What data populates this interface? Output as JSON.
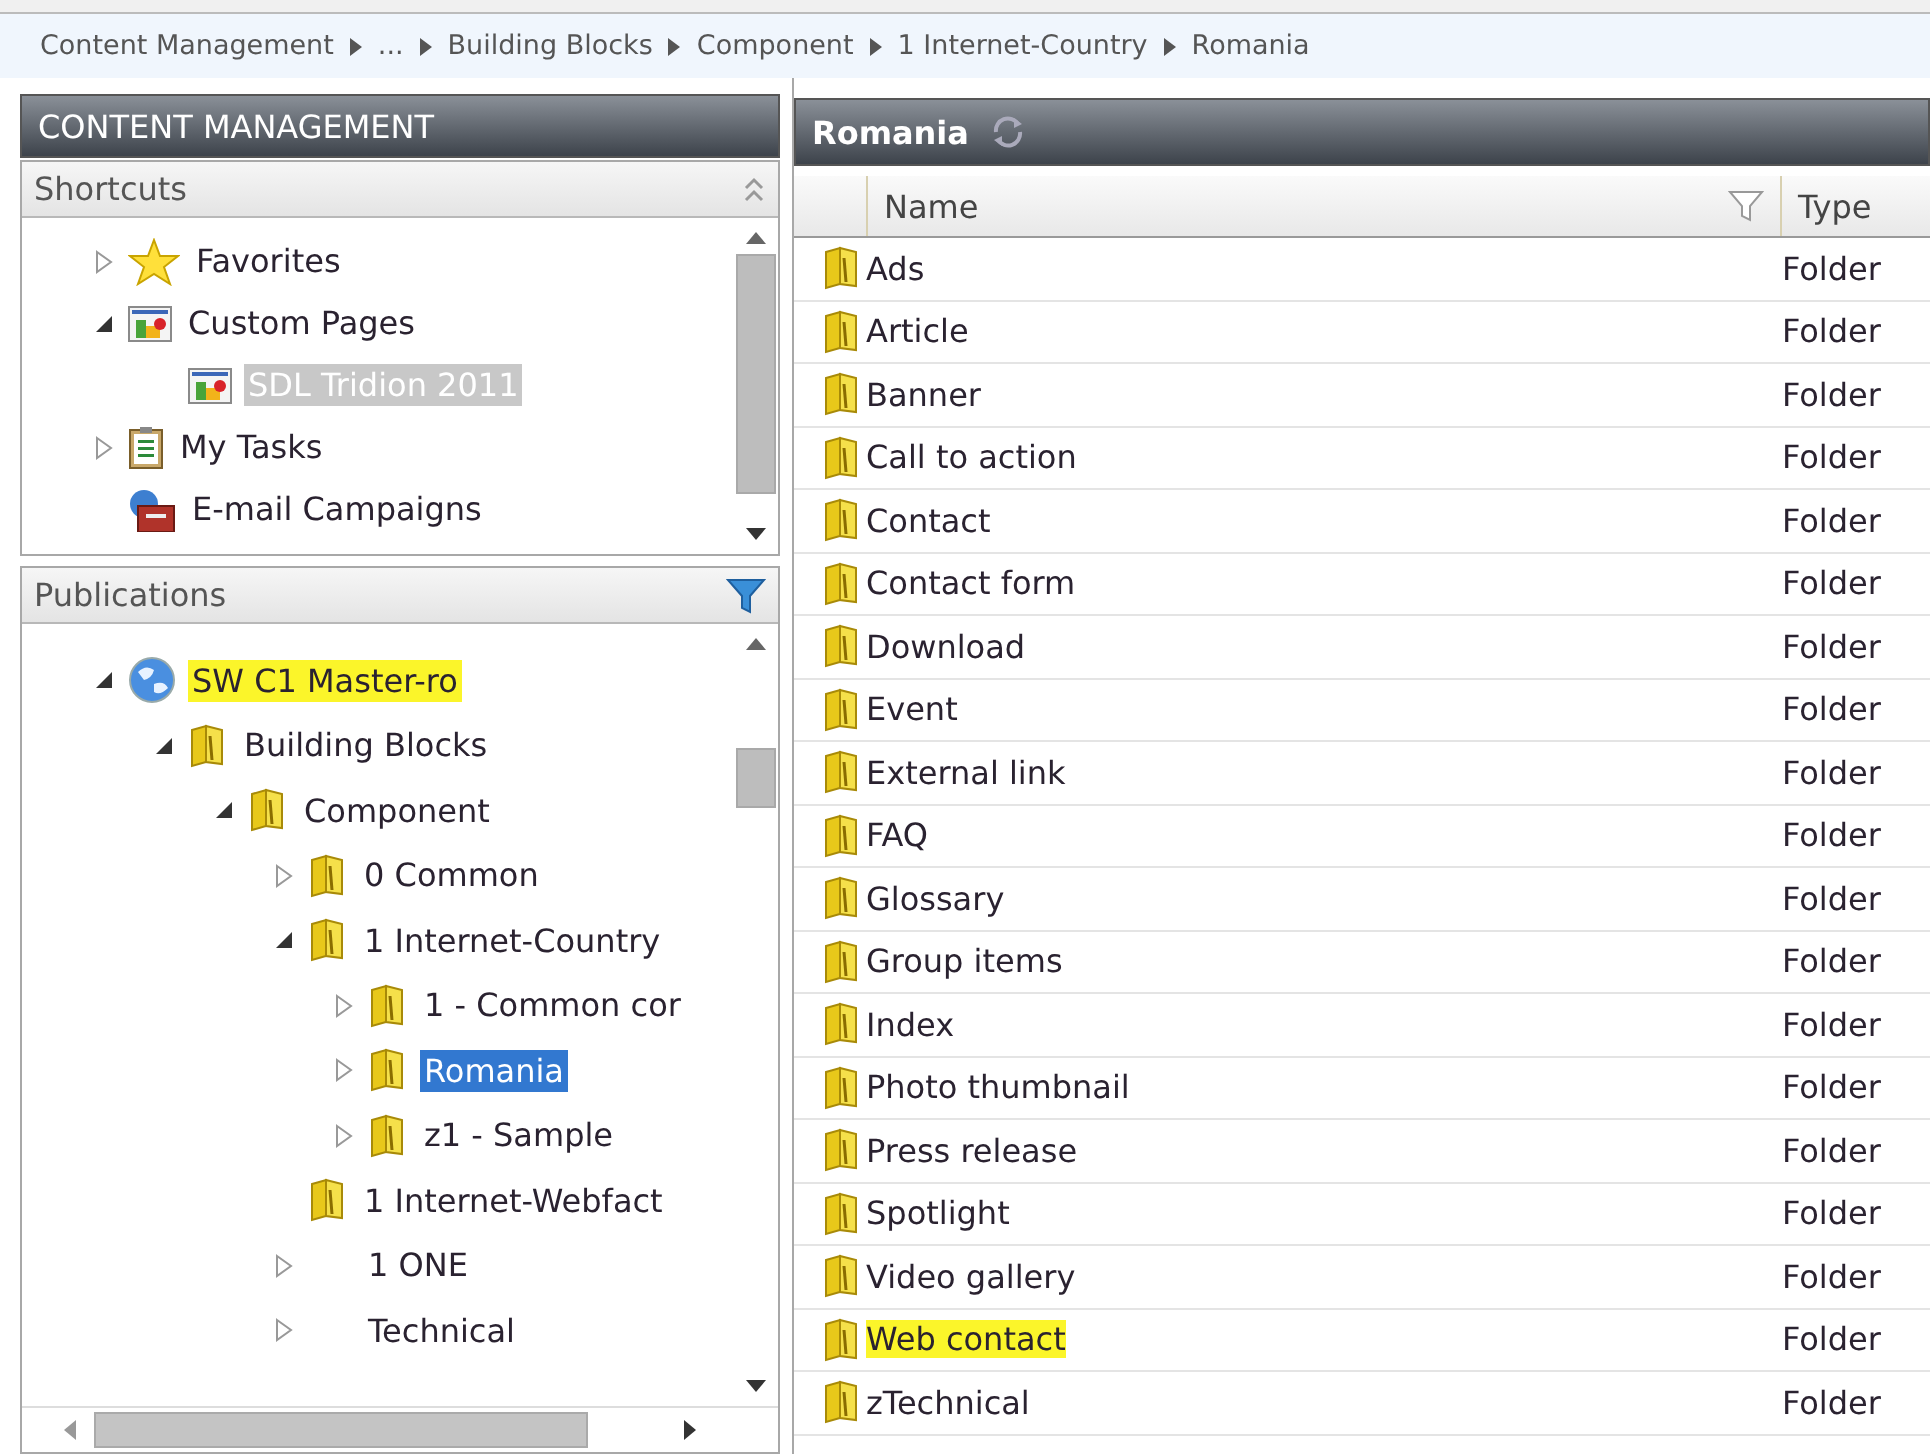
{
  "breadcrumb": [
    "Content Management",
    "...",
    "Building Blocks",
    "Component",
    "1 Internet-Country",
    "Romania"
  ],
  "left_panel": {
    "title": "CONTENT MANAGEMENT",
    "shortcuts": {
      "title": "Shortcuts",
      "focused": false,
      "items": [
        {
          "label": "Favorites",
          "kind": "star",
          "expanded": false,
          "selected": false,
          "highlighted": false
        },
        {
          "label": "Custom Pages",
          "kind": "page",
          "expanded": true,
          "selected": false,
          "highlighted": false,
          "children": [
            {
              "label": "SDL Tridion 2011",
              "kind": "page",
              "selected": true,
              "highlighted": false
            }
          ]
        },
        {
          "label": "My Tasks",
          "kind": "tasks",
          "expanded": false,
          "selected": false,
          "highlighted": false
        },
        {
          "label": "E-mail Campaigns",
          "kind": "campaign",
          "selected": false,
          "highlighted": false
        }
      ]
    },
    "publications": {
      "title": "Publications",
      "focused": true,
      "items": [
        {
          "label": "SW C1 Master-ro",
          "kind": "globe",
          "expanded": true,
          "selected": false,
          "highlighted": true,
          "children": [
            {
              "label": "Building Blocks",
              "kind": "folder",
              "expanded": true,
              "selected": false,
              "highlighted": false,
              "children": [
                {
                  "label": "Component",
                  "kind": "folder",
                  "expanded": true,
                  "selected": false,
                  "highlighted": false,
                  "children": [
                    {
                      "label": "0 Common",
                      "kind": "folder",
                      "expanded": false,
                      "selected": false,
                      "highlighted": false
                    },
                    {
                      "label": "1 Internet-Country",
                      "kind": "folder",
                      "expanded": true,
                      "selected": false,
                      "highlighted": false,
                      "children": [
                        {
                          "label": "1 - Common cor",
                          "kind": "folder",
                          "expanded": false,
                          "selected": false,
                          "highlighted": false
                        },
                        {
                          "label": "Romania",
                          "kind": "folder",
                          "expanded": false,
                          "selected": true,
                          "highlighted": false
                        },
                        {
                          "label": "z1 - Sample",
                          "kind": "folder",
                          "expanded": false,
                          "selected": false,
                          "highlighted": false
                        }
                      ]
                    },
                    {
                      "label": "1 Internet-Webfact",
                      "kind": "folder",
                      "selected": false,
                      "highlighted": false
                    },
                    {
                      "label": "1 ONE",
                      "kind": "plain",
                      "expanded": false,
                      "selected": false,
                      "highlighted": false
                    },
                    {
                      "label": "Technical",
                      "kind": "plain",
                      "expanded": false,
                      "selected": false,
                      "highlighted": false
                    }
                  ]
                }
              ]
            }
          ]
        }
      ]
    }
  },
  "right_panel": {
    "title": "Romania",
    "columns": [
      "Name",
      "Type"
    ],
    "rows": [
      {
        "name": "Ads",
        "type": "Folder",
        "highlighted": false
      },
      {
        "name": "Article",
        "type": "Folder",
        "highlighted": false
      },
      {
        "name": "Banner",
        "type": "Folder",
        "highlighted": false
      },
      {
        "name": "Call to action",
        "type": "Folder",
        "highlighted": false
      },
      {
        "name": "Contact",
        "type": "Folder",
        "highlighted": false
      },
      {
        "name": "Contact form",
        "type": "Folder",
        "highlighted": false
      },
      {
        "name": "Download",
        "type": "Folder",
        "highlighted": false
      },
      {
        "name": "Event",
        "type": "Folder",
        "highlighted": false
      },
      {
        "name": "External link",
        "type": "Folder",
        "highlighted": false
      },
      {
        "name": "FAQ",
        "type": "Folder",
        "highlighted": false
      },
      {
        "name": "Glossary",
        "type": "Folder",
        "highlighted": false
      },
      {
        "name": "Group items",
        "type": "Folder",
        "highlighted": false
      },
      {
        "name": "Index",
        "type": "Folder",
        "highlighted": false
      },
      {
        "name": "Photo thumbnail",
        "type": "Folder",
        "highlighted": false
      },
      {
        "name": "Press release",
        "type": "Folder",
        "highlighted": false
      },
      {
        "name": "Spotlight",
        "type": "Folder",
        "highlighted": false
      },
      {
        "name": "Video gallery",
        "type": "Folder",
        "highlighted": false
      },
      {
        "name": "Web contact",
        "type": "Folder",
        "highlighted": true
      },
      {
        "name": "zTechnical",
        "type": "Folder",
        "highlighted": false
      }
    ]
  }
}
